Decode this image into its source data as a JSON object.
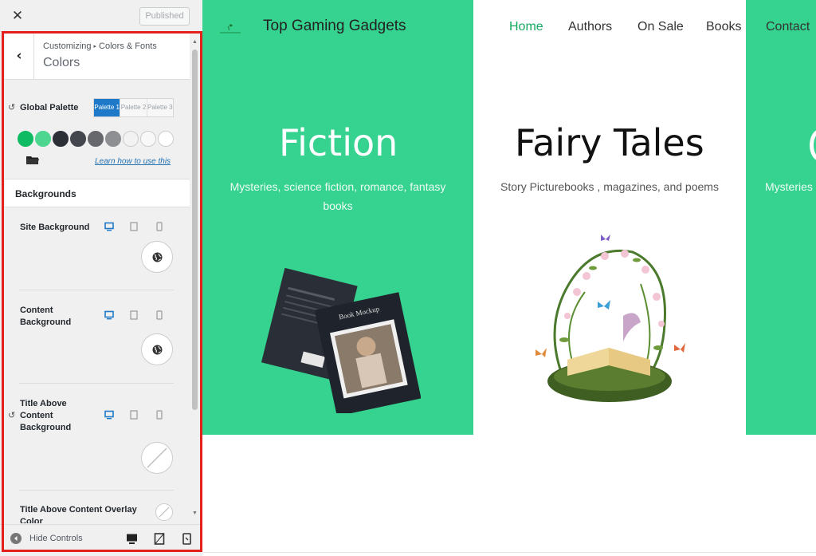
{
  "customizer": {
    "close_icon": "close-icon",
    "published_label": "Published",
    "breadcrumb": {
      "root": "Customizing",
      "parent": "Colors & Fonts"
    },
    "panel_title": "Colors",
    "global_palette": {
      "label": "Global Palette",
      "tabs": [
        "Palette 1",
        "Palette 2",
        "Palette 3"
      ],
      "active_tab": "Palette 1",
      "swatches": [
        "#0dbb63",
        "#4dd68f",
        "#2c2f36",
        "#44474d",
        "#66686d",
        "#8e8f92",
        "#f2f2f2",
        "#f8f8f8",
        "#ffffff"
      ],
      "learn_link": "Learn how to use this"
    },
    "backgrounds": {
      "section_title": "Backgrounds",
      "site_background": "Site Background",
      "content_background": [
        "Content",
        "Background"
      ],
      "title_above_content_background": [
        "Title Above",
        "Content",
        "Background"
      ],
      "title_above_content_overlay": [
        "Title Above Content Overlay",
        "Color"
      ]
    },
    "footer": {
      "hide_controls": "Hide Controls"
    }
  },
  "preview": {
    "site_title": "Top Gaming Gadgets",
    "nav": [
      "Home",
      "Authors",
      "On Sale",
      "Books",
      "Contact"
    ],
    "active_nav": "Home",
    "cards": [
      {
        "title": "Fiction",
        "subtitle": [
          "Mysteries, science fiction, romance, fantasy",
          "books"
        ]
      },
      {
        "title": "Fairy Tales",
        "subtitle": [
          "Story Picturebooks , magazines, and poems"
        ]
      },
      {
        "title": "",
        "subtitle": [
          "Mysteries"
        ]
      }
    ],
    "book_cover": {
      "title": "Book Mockup"
    }
  },
  "colors": {
    "accent_green": "#36d28f",
    "nav_active": "#17a862",
    "annotation_red": "#e3201b",
    "link_blue": "#2271b1"
  }
}
